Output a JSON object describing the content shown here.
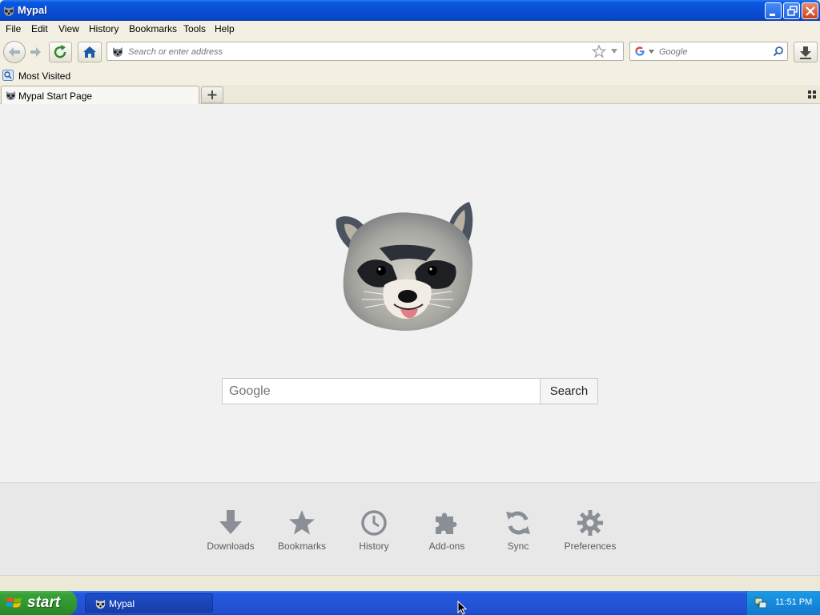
{
  "window": {
    "title": "Mypal"
  },
  "menu": [
    "File",
    "Edit",
    "View",
    "History",
    "Bookmarks",
    "Tools",
    "Help"
  ],
  "urlbar": {
    "placeholder": "Search or enter address"
  },
  "searchbar": {
    "engine": "Google",
    "placeholder": "Google"
  },
  "bookmarks": {
    "most_visited": "Most Visited"
  },
  "tabs": [
    {
      "title": "Mypal Start Page"
    }
  ],
  "page": {
    "search_placeholder": "Google",
    "search_button": "Search",
    "launcher": [
      {
        "label": "Downloads",
        "icon": "download-icon"
      },
      {
        "label": "Bookmarks",
        "icon": "star-icon"
      },
      {
        "label": "History",
        "icon": "clock-icon"
      },
      {
        "label": "Add-ons",
        "icon": "puzzle-icon"
      },
      {
        "label": "Sync",
        "icon": "sync-icon"
      },
      {
        "label": "Preferences",
        "icon": "gear-icon"
      }
    ]
  },
  "taskbar": {
    "start": "start",
    "task": "Mypal",
    "clock": "11:51 PM"
  },
  "colors": {
    "titlebar": "#0a4fd6",
    "taskbar": "#2554d8",
    "start": "#2f962f",
    "launcher_icon": "#8a8f97"
  }
}
